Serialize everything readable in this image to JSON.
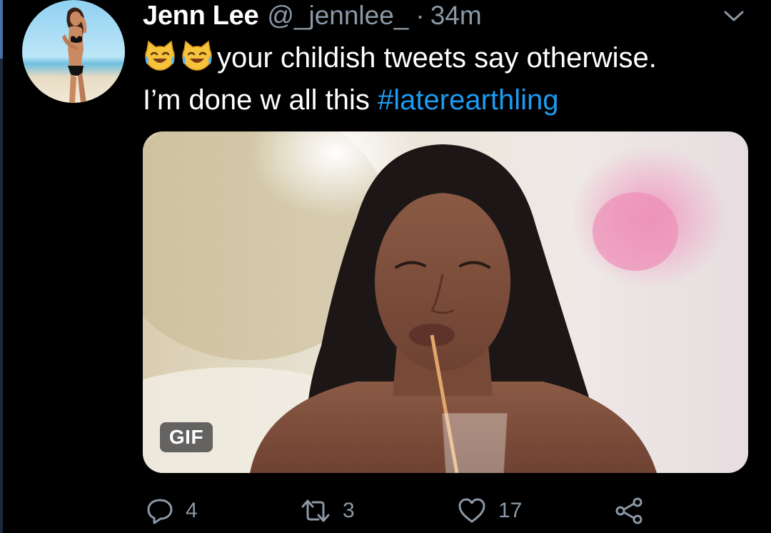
{
  "tweet": {
    "author": {
      "name": "Jenn Lee",
      "handle": "@_jennlee_",
      "separator": "·",
      "time": "34m"
    },
    "text": {
      "emojis": [
        "cat-tears-of-joy-emoji",
        "cat-tears-of-joy-emoji"
      ],
      "line1": "your childish tweets say otherwise.",
      "line2_prefix": "I’m done w all this ",
      "hashtag": "#laterearthling"
    },
    "media": {
      "badge": "GIF"
    },
    "actions": {
      "reply_count": "4",
      "retweet_count": "3",
      "like_count": "17"
    }
  },
  "colors": {
    "background": "#000000",
    "secondary_text": "#8b98a5",
    "link": "#1d9bf0",
    "text": "#ffffff"
  },
  "icons": [
    "chevron-down-icon",
    "reply-icon",
    "retweet-icon",
    "like-icon",
    "share-icon"
  ]
}
